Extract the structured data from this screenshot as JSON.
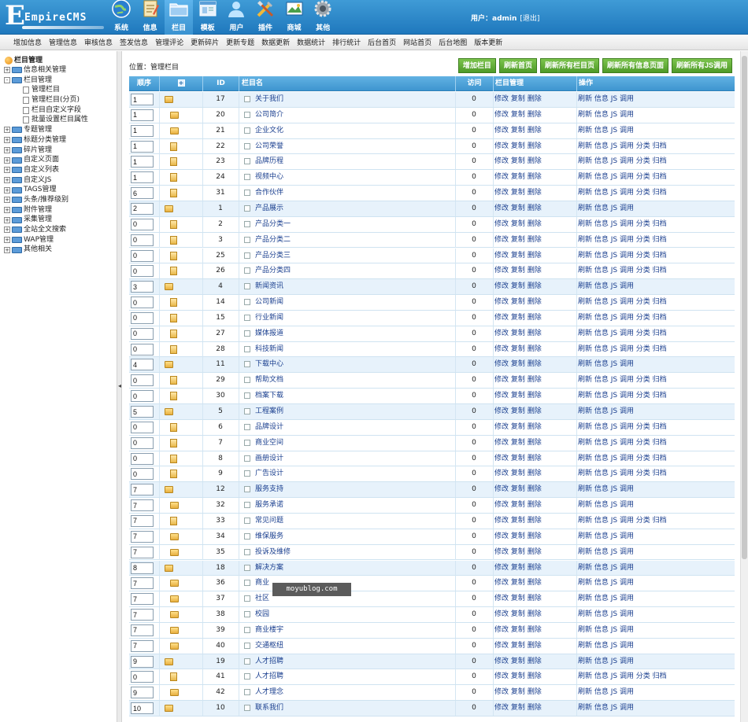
{
  "app": {
    "logo_text": "EmpireCMS"
  },
  "topnav": [
    {
      "label": "系统",
      "icon": "globe-icon"
    },
    {
      "label": "信息",
      "icon": "notepad-icon"
    },
    {
      "label": "栏目",
      "icon": "folder-icon",
      "active": true
    },
    {
      "label": "模板",
      "icon": "template-window-icon"
    },
    {
      "label": "用户",
      "icon": "user-icon"
    },
    {
      "label": "插件",
      "icon": "tools-icon"
    },
    {
      "label": "商城",
      "icon": "shop-icon"
    },
    {
      "label": "其他",
      "icon": "gear-icon"
    }
  ],
  "user": {
    "prefix": "用户：",
    "name": "admin",
    "logout": "[退出]"
  },
  "subnav": [
    "增加信息",
    "管理信息",
    "审核信息",
    "签发信息",
    "管理评论",
    "更新碎片",
    "更新专题",
    "数据更新",
    "数据统计",
    "排行统计",
    "后台首页",
    "网站首页",
    "后台地图",
    "版本更新"
  ],
  "sidebar": {
    "root": "栏目管理",
    "items": [
      {
        "label": "信息相关管理",
        "level": 1,
        "state": "+"
      },
      {
        "label": "栏目管理",
        "level": 1,
        "state": "-"
      },
      {
        "label": "管理栏目",
        "level": 2
      },
      {
        "label": "管理栏目(分页)",
        "level": 2
      },
      {
        "label": "栏目自定义字段",
        "level": 2
      },
      {
        "label": "批量设置栏目属性",
        "level": 2
      },
      {
        "label": "专题管理",
        "level": 1,
        "state": "+"
      },
      {
        "label": "标题分类管理",
        "level": 1,
        "state": "+"
      },
      {
        "label": "碎片管理",
        "level": 1,
        "state": "+"
      },
      {
        "label": "自定义页面",
        "level": 1,
        "state": "+"
      },
      {
        "label": "自定义列表",
        "level": 1,
        "state": "+"
      },
      {
        "label": "自定义JS",
        "level": 1,
        "state": "+"
      },
      {
        "label": "TAGS管理",
        "level": 1,
        "state": "+"
      },
      {
        "label": "头条/推荐级别",
        "level": 1,
        "state": "+"
      },
      {
        "label": "附件管理",
        "level": 1,
        "state": "+"
      },
      {
        "label": "采集管理",
        "level": 1,
        "state": "+"
      },
      {
        "label": "全站全文搜索",
        "level": 1,
        "state": "+"
      },
      {
        "label": "WAP管理",
        "level": 1,
        "state": "+"
      },
      {
        "label": "其他相关",
        "level": 1,
        "state": "+"
      }
    ]
  },
  "splitter": {
    "arrow": "◂"
  },
  "position": {
    "text": "位置：管理栏目"
  },
  "buttons": [
    "增加栏目",
    "刷新首页",
    "刷新所有栏目页",
    "刷新所有信息页面",
    "刷新所有JS调用"
  ],
  "table": {
    "headers": {
      "order": "顺序",
      "expand": "+",
      "id": "ID",
      "name": "栏目名",
      "visits": "访问",
      "manage": "栏目管理",
      "ops": "操作"
    },
    "manage_links": "修改 复制 删除",
    "ops_top": "刷新 信息 JS 调用",
    "ops_sub": "刷新 信息 JS 调用 分类 归档",
    "rows": [
      {
        "order": "1",
        "id": "17",
        "name": "关于我们",
        "visits": "0",
        "kind": "top"
      },
      {
        "order": "1",
        "id": "20",
        "name": "公司简介",
        "visits": "0",
        "kind": "subtop"
      },
      {
        "order": "1",
        "id": "21",
        "name": "企业文化",
        "visits": "0",
        "kind": "subtop"
      },
      {
        "order": "1",
        "id": "22",
        "name": "公司荣誉",
        "visits": "0",
        "kind": "sub"
      },
      {
        "order": "1",
        "id": "23",
        "name": "品牌历程",
        "visits": "0",
        "kind": "sub"
      },
      {
        "order": "1",
        "id": "24",
        "name": "视频中心",
        "visits": "0",
        "kind": "sub"
      },
      {
        "order": "6",
        "id": "31",
        "name": "合作伙伴",
        "visits": "0",
        "kind": "sub"
      },
      {
        "order": "2",
        "id": "1",
        "name": "产品展示",
        "visits": "0",
        "kind": "top"
      },
      {
        "order": "0",
        "id": "2",
        "name": "产品分类一",
        "visits": "0",
        "kind": "sub"
      },
      {
        "order": "0",
        "id": "3",
        "name": "产品分类二",
        "visits": "0",
        "kind": "sub"
      },
      {
        "order": "0",
        "id": "25",
        "name": "产品分类三",
        "visits": "0",
        "kind": "sub"
      },
      {
        "order": "0",
        "id": "26",
        "name": "产品分类四",
        "visits": "0",
        "kind": "sub"
      },
      {
        "order": "3",
        "id": "4",
        "name": "新闻资讯",
        "visits": "0",
        "kind": "top"
      },
      {
        "order": "0",
        "id": "14",
        "name": "公司新闻",
        "visits": "0",
        "kind": "sub"
      },
      {
        "order": "0",
        "id": "15",
        "name": "行业新闻",
        "visits": "0",
        "kind": "sub"
      },
      {
        "order": "0",
        "id": "27",
        "name": "媒体报道",
        "visits": "0",
        "kind": "sub"
      },
      {
        "order": "0",
        "id": "28",
        "name": "科技新闻",
        "visits": "0",
        "kind": "sub"
      },
      {
        "order": "4",
        "id": "11",
        "name": "下载中心",
        "visits": "0",
        "kind": "top"
      },
      {
        "order": "0",
        "id": "29",
        "name": "帮助文档",
        "visits": "0",
        "kind": "sub"
      },
      {
        "order": "0",
        "id": "30",
        "name": "档案下载",
        "visits": "0",
        "kind": "sub"
      },
      {
        "order": "5",
        "id": "5",
        "name": "工程案例",
        "visits": "0",
        "kind": "top"
      },
      {
        "order": "0",
        "id": "6",
        "name": "品牌设计",
        "visits": "0",
        "kind": "sub"
      },
      {
        "order": "0",
        "id": "7",
        "name": "商业空间",
        "visits": "0",
        "kind": "sub"
      },
      {
        "order": "0",
        "id": "8",
        "name": "画册设计",
        "visits": "0",
        "kind": "sub"
      },
      {
        "order": "0",
        "id": "9",
        "name": "广告设计",
        "visits": "0",
        "kind": "sub"
      },
      {
        "order": "7",
        "id": "12",
        "name": "服务支持",
        "visits": "0",
        "kind": "top"
      },
      {
        "order": "7",
        "id": "32",
        "name": "服务承诺",
        "visits": "0",
        "kind": "subtop"
      },
      {
        "order": "7",
        "id": "33",
        "name": "常见问题",
        "visits": "0",
        "kind": "sub"
      },
      {
        "order": "7",
        "id": "34",
        "name": "维保服务",
        "visits": "0",
        "kind": "subtop"
      },
      {
        "order": "7",
        "id": "35",
        "name": "投诉及维修",
        "visits": "0",
        "kind": "subtop"
      },
      {
        "order": "8",
        "id": "18",
        "name": "解决方案",
        "visits": "0",
        "kind": "top"
      },
      {
        "order": "7",
        "id": "36",
        "name": "商业",
        "visits": "0",
        "kind": "subtop"
      },
      {
        "order": "7",
        "id": "37",
        "name": "社区",
        "visits": "0",
        "kind": "subtop"
      },
      {
        "order": "7",
        "id": "38",
        "name": "校园",
        "visits": "0",
        "kind": "subtop"
      },
      {
        "order": "7",
        "id": "39",
        "name": "商业楼宇",
        "visits": "0",
        "kind": "subtop"
      },
      {
        "order": "7",
        "id": "40",
        "name": "交通枢纽",
        "visits": "0",
        "kind": "subtop"
      },
      {
        "order": "9",
        "id": "19",
        "name": "人才招聘",
        "visits": "0",
        "kind": "top"
      },
      {
        "order": "0",
        "id": "41",
        "name": "人才招聘",
        "visits": "0",
        "kind": "sub"
      },
      {
        "order": "9",
        "id": "42",
        "name": "人才理念",
        "visits": "0",
        "kind": "subtop"
      },
      {
        "order": "10",
        "id": "10",
        "name": "联系我们",
        "visits": "0",
        "kind": "top"
      }
    ]
  },
  "watermark": {
    "text": "moyublog.com"
  },
  "colors": {
    "header_blue": "#3e95cf",
    "green_button": "#4e9a28",
    "top_row": "#e7f2fb"
  }
}
